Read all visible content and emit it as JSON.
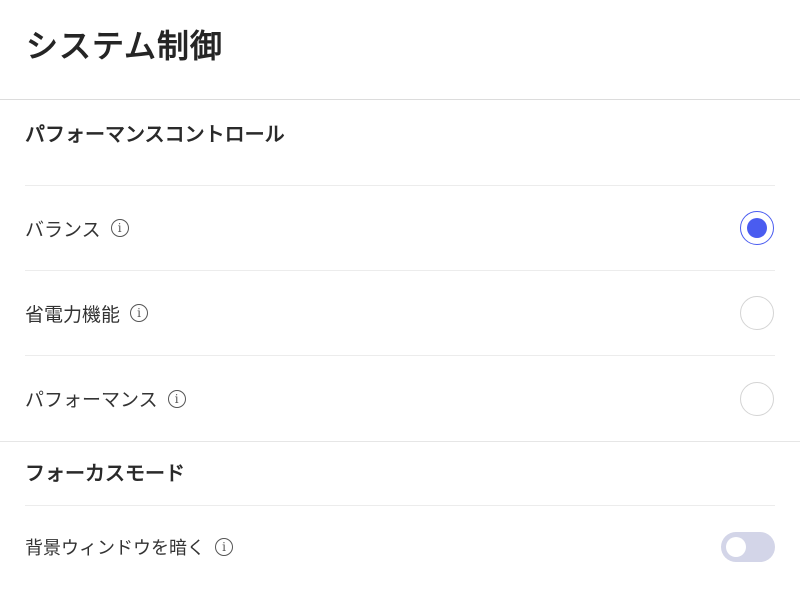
{
  "header": {
    "title": "システム制御"
  },
  "performance": {
    "title": "パフォーマンスコントロール",
    "options": [
      {
        "label": "バランス",
        "info_icon": "info-icon",
        "selected": true
      },
      {
        "label": "省電力機能",
        "info_icon": "info-icon",
        "selected": false
      },
      {
        "label": "パフォーマンス",
        "info_icon": "info-icon",
        "selected": false
      }
    ]
  },
  "focus": {
    "title": "フォーカスモード",
    "dim_background": {
      "label": "背景ウィンドウを暗く",
      "info_icon": "info-icon",
      "enabled": false
    }
  },
  "icons": {
    "info_glyph": "i"
  },
  "colors": {
    "accent": "#4a5cf0",
    "toggle_off_track": "#d3d5e8"
  }
}
